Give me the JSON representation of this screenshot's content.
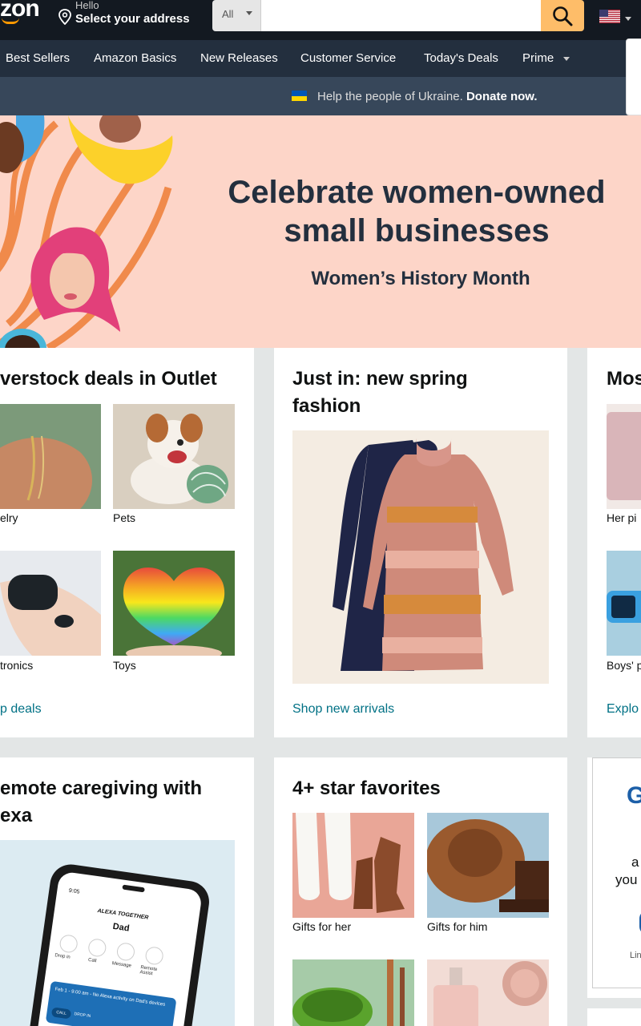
{
  "header": {
    "logo_text": "zon",
    "hello": "Hello",
    "address": "Select your address",
    "search_category": "All",
    "search_placeholder": "",
    "country": "US"
  },
  "nav": {
    "items": [
      "Best Sellers",
      "Amazon Basics",
      "New Releases",
      "Customer Service",
      "Today's Deals",
      "Prime"
    ]
  },
  "ukraine": {
    "message": "Help the people of Ukraine.",
    "cta": "Donate now."
  },
  "hero": {
    "title_line1": "Celebrate women-owned",
    "title_line2": "small businesses",
    "subtitle": "Women’s History Month"
  },
  "cards": {
    "outlet": {
      "title": "verstock deals in Outlet",
      "tiles": [
        "elry",
        "Pets",
        "tronics",
        "Toys"
      ],
      "link": "p deals"
    },
    "spring": {
      "title_line1": "Just in: new spring",
      "title_line2": "fashion",
      "link": "Shop new arrivals"
    },
    "right1": {
      "title": "Mos",
      "tiles": [
        "Her pi",
        "Boys' p"
      ],
      "link": "Explo"
    },
    "caregiving": {
      "title_line1": "emote caregiving with",
      "title_line2": "exa",
      "phone": {
        "time": "9:05",
        "header": "ALEXA TOGETHER",
        "name": "Dad",
        "actions": [
          "Drop in",
          "Call",
          "Message",
          "Remote Assist"
        ],
        "alert": "Feb 1 - 9:00 am - No Alexa activity on Dad's devices",
        "buttons": [
          "CALL",
          "DROP IN"
        ]
      }
    },
    "favorites": {
      "title": "4+ star favorites",
      "tiles": [
        "Gifts for her",
        "Gifts for him"
      ]
    },
    "right2": {
      "letter": "G",
      "line1": "a",
      "line2": "you",
      "line3": "Lin"
    }
  }
}
